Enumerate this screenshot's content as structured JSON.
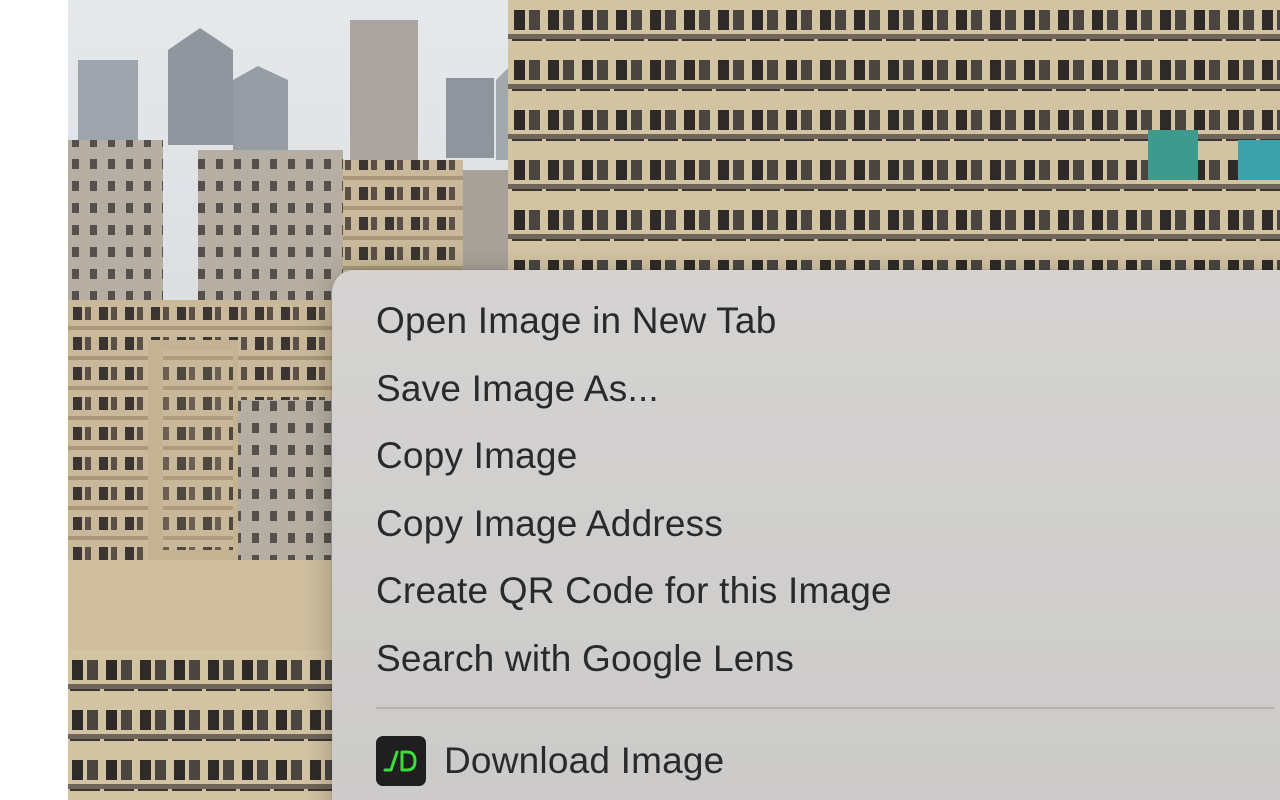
{
  "context_menu": {
    "items": [
      {
        "label": "Open Image in New Tab"
      },
      {
        "label": "Save Image As..."
      },
      {
        "label": "Copy Image"
      },
      {
        "label": "Copy Image Address"
      },
      {
        "label": "Create QR Code for this Image"
      },
      {
        "label": "Search with Google Lens"
      }
    ],
    "extension_item": {
      "label": "Download Image",
      "icon": "download-extension-icon",
      "icon_color": "#3ddc3d"
    }
  },
  "colors": {
    "menu_background": "#d0cfce",
    "menu_text": "#2a2a2a",
    "separator": "#b3b2b1"
  }
}
